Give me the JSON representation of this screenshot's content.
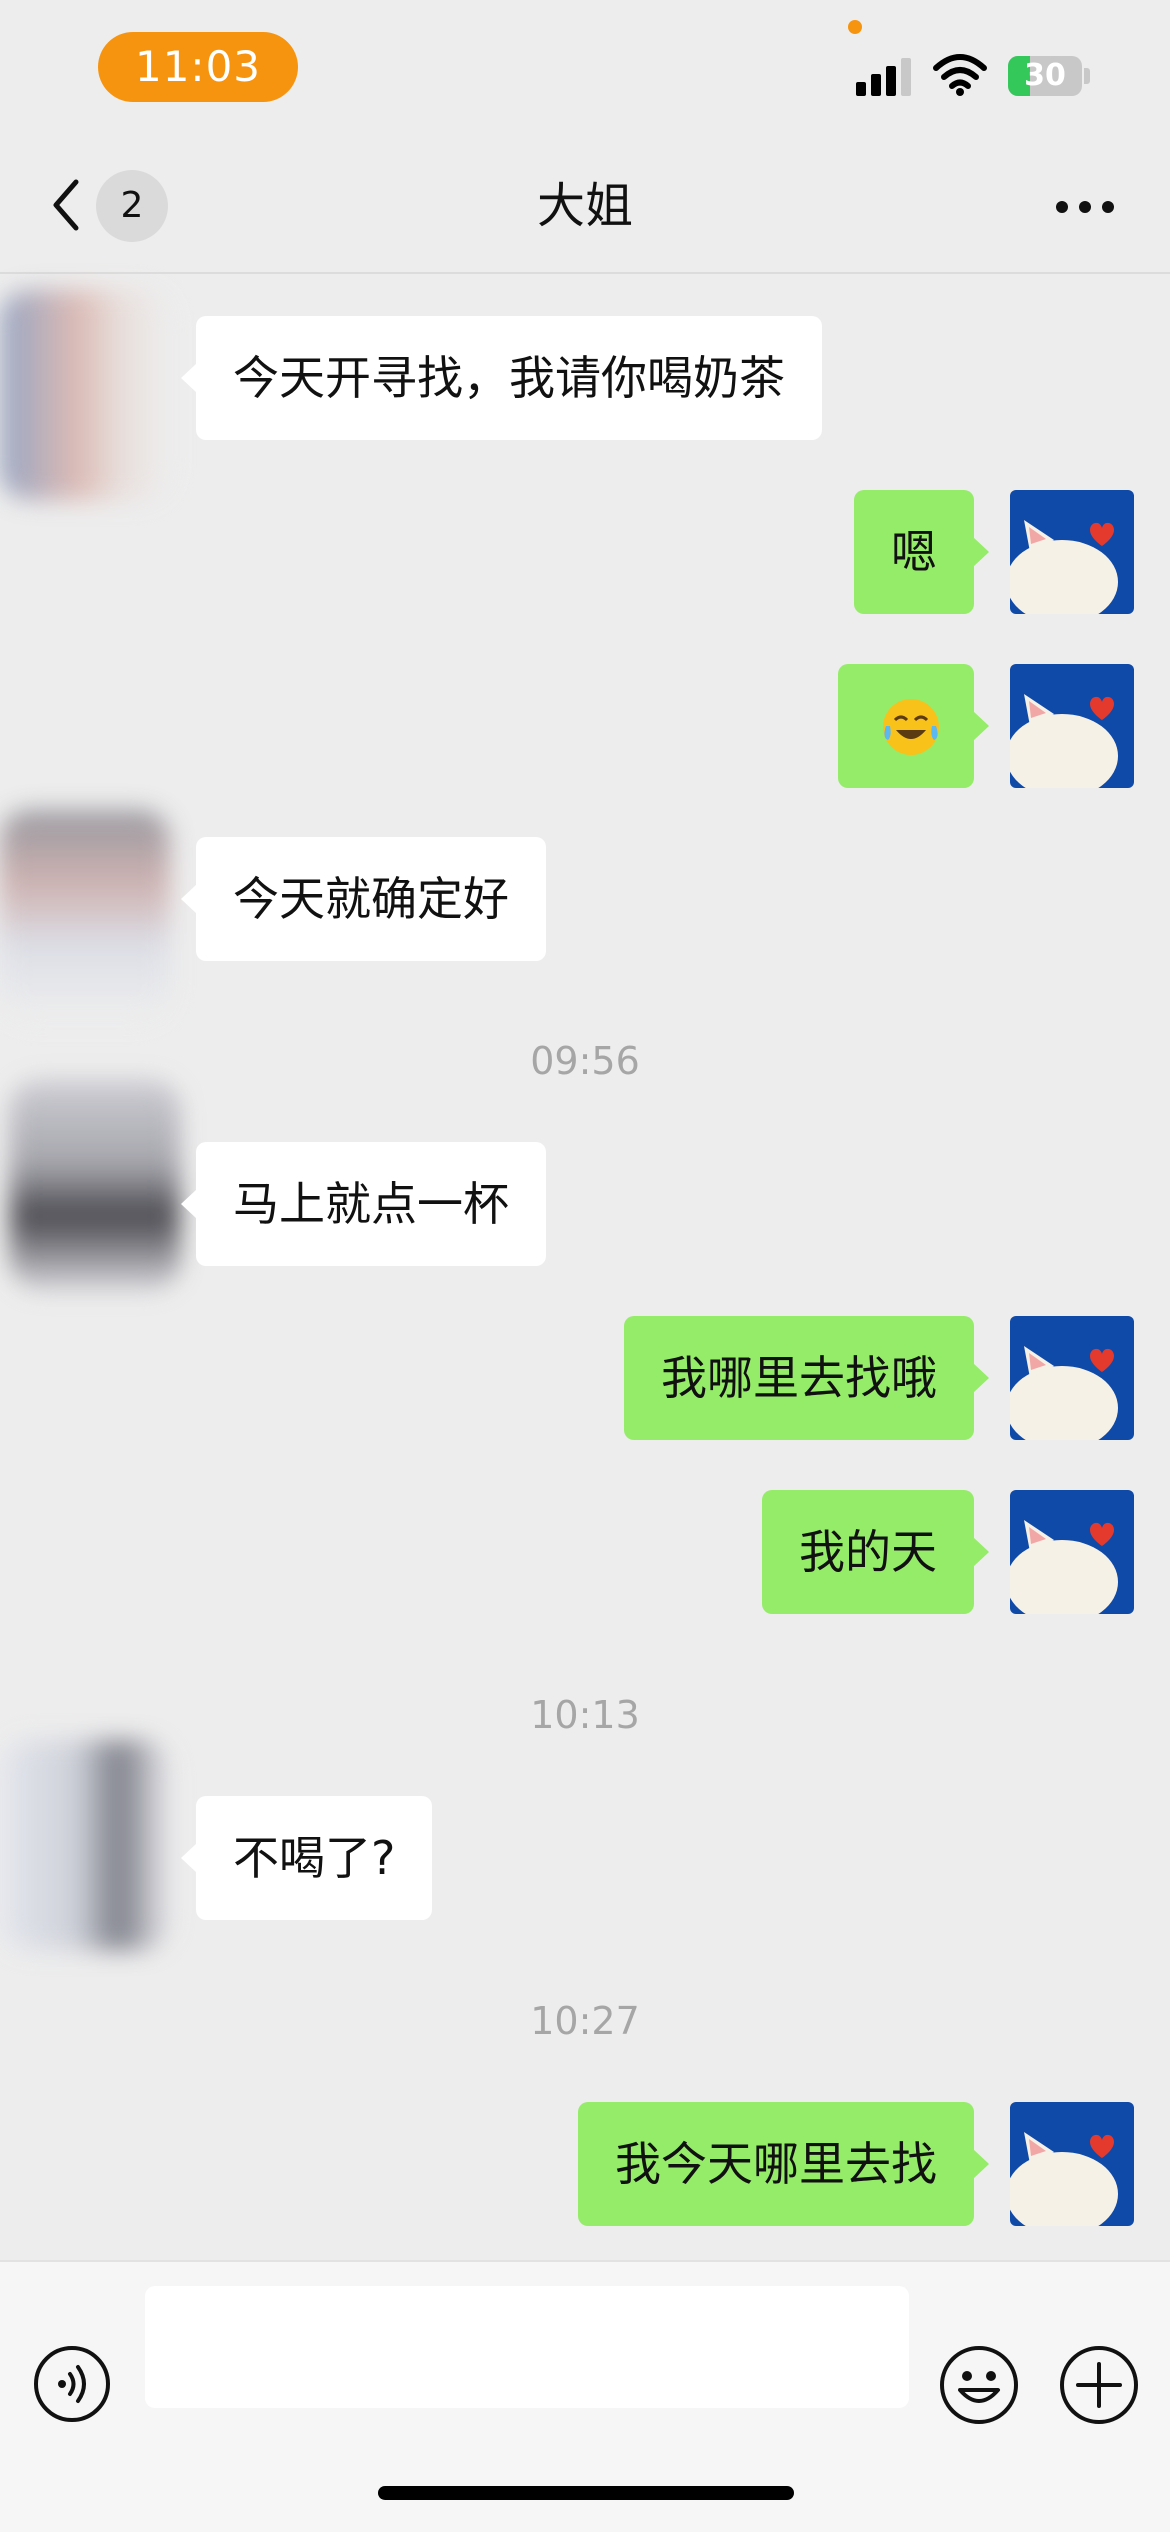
{
  "status_bar": {
    "time": "11:03",
    "battery": "30",
    "colors": {
      "pill": "#f7940f",
      "battery_fill": "#34c759"
    }
  },
  "nav": {
    "back_icon": "chevron-left-icon",
    "unread_count": "2",
    "title": "大姐",
    "more_icon": "more-dots-icon"
  },
  "messages": [
    {
      "side": "in",
      "text": "今天开寻找，我请你喝奶茶"
    },
    {
      "side": "out",
      "text": "嗯"
    },
    {
      "side": "out",
      "text": "",
      "emoji": "laughing-crying-face-icon"
    },
    {
      "side": "in",
      "text": "今天就确定好"
    },
    {
      "type": "time",
      "text": "09:56"
    },
    {
      "side": "in",
      "text": "马上就点一杯"
    },
    {
      "side": "out",
      "text": "我哪里去找哦"
    },
    {
      "side": "out",
      "text": "我的天"
    },
    {
      "type": "time",
      "text": "10:13"
    },
    {
      "side": "in",
      "text": "不喝了?"
    },
    {
      "type": "time",
      "text": "10:27"
    },
    {
      "side": "out",
      "text": "我今天哪里去找"
    }
  ],
  "input_bar": {
    "voice_icon": "voice-icon",
    "text_value": "",
    "emoji_icon": "emoji-icon",
    "plus_icon": "plus-icon"
  },
  "colors": {
    "background": "#ededed",
    "outgoing_bubble": "#95ec69",
    "incoming_bubble": "#ffffff",
    "self_avatar_bg": "#0f4aa8"
  }
}
